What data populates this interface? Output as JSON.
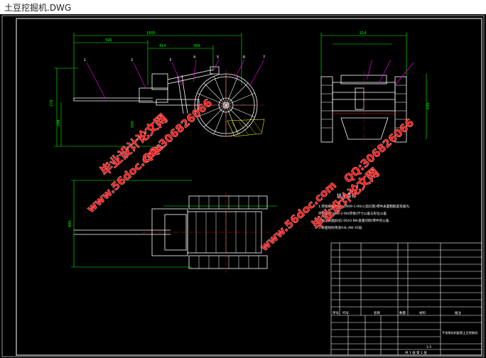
{
  "window": {
    "title": "土豆挖掘机.DWG"
  },
  "drawing": {
    "front_view_dims": [
      "1605",
      "590",
      "414",
      "399",
      "270",
      "288",
      "500"
    ],
    "part_labels": [
      "1",
      "2",
      "3",
      "4",
      "5",
      "6",
      "7"
    ],
    "side_view_dims": [
      "914",
      "640"
    ],
    "plan_view_dims": [
      "900"
    ],
    "technical_requirements": {
      "title": "技术条件",
      "lines": [
        "1.焊接结构件JB/J 5909-1-90(火焰切割)零件表面粗糙度等级为.",
        "  焊缝JB/J 5909-2-90(焊接)尺寸公差与形位公差.",
        "2.加工表面JB/JQ 0643-88(金属切削)零件的公差.",
        "3.表面喷防锈漆A3L-AW 45层."
      ]
    },
    "title_block": {
      "scale": "1:5",
      "sheet": "共 1 张 第 1 张",
      "drawing_name": "手扶拖拉机配套土豆挖掘机",
      "columns": [
        "序号",
        "代号",
        "名称",
        "数量",
        "材料",
        "备注"
      ]
    }
  },
  "watermarks": {
    "site1": "毕业设计论文网",
    "url1": "www.56doc.com",
    "qq1": "QQ:306826066",
    "site2": "毕业设计论文网",
    "url2": "www.56doc.com",
    "qq2": "QQ:306826066"
  },
  "colors": {
    "background": "#000000",
    "frame": "#ffffff",
    "dimension": "#00ff00",
    "centerline": "#ff0000",
    "leader": "#ff00ff",
    "hatch": "#ffff00",
    "watermark": "#ff1a1a"
  }
}
